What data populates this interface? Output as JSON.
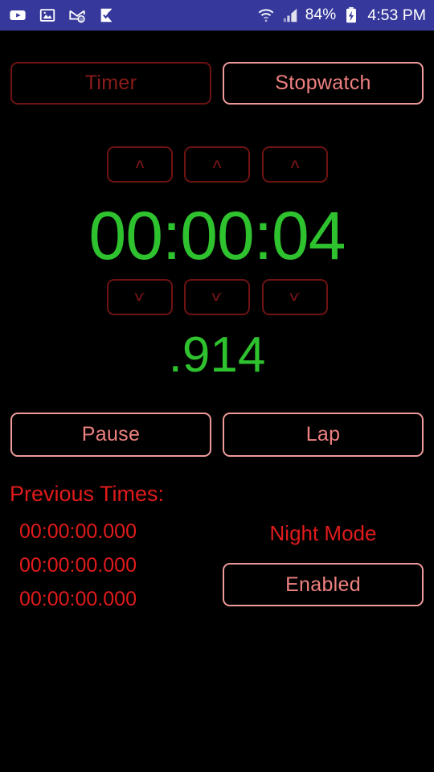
{
  "status_bar": {
    "background_color": "#36399b",
    "left_icons": [
      {
        "name": "youtube-icon",
        "glyph": "youtube"
      },
      {
        "name": "gallery-image-icon",
        "glyph": "image"
      },
      {
        "name": "email-at-icon",
        "glyph": "envelope-at"
      },
      {
        "name": "checkmark-flag-icon",
        "glyph": "flag-check"
      }
    ],
    "wifi_icon": "wifi-icon",
    "signal_icon": "cellular-signal-icon",
    "battery_percent": "84%",
    "battery_icon": "battery-charging-icon",
    "time": "4:53 PM"
  },
  "colors": {
    "background": "#000000",
    "accent_active": "#ef8080",
    "accent_inactive": "#8b1b1b",
    "border_active": "#ef9a9a",
    "border_inactive": "#6e1212",
    "clock_green": "#2fc22f",
    "label_red": "#e01b1b"
  },
  "modes": {
    "timer_label": "Timer",
    "stopwatch_label": "Stopwatch",
    "selected": "Stopwatch"
  },
  "steppers": {
    "up_glyph": "ʌ",
    "down_glyph": "ѵ",
    "up_buttons": [
      {
        "name": "hours-increment-button"
      },
      {
        "name": "minutes-increment-button"
      },
      {
        "name": "seconds-increment-button"
      }
    ],
    "down_buttons": [
      {
        "name": "hours-decrement-button"
      },
      {
        "name": "minutes-decrement-button"
      },
      {
        "name": "seconds-decrement-button"
      }
    ]
  },
  "clock": {
    "main": "00:00:04",
    "milliseconds": ".914"
  },
  "actions": {
    "pause_label": "Pause",
    "lap_label": "Lap"
  },
  "previous_times": {
    "title": "Previous Times:",
    "entries": [
      "00:00:00.000",
      "00:00:00.000",
      "00:00:00.000"
    ]
  },
  "night_mode": {
    "label": "Night Mode",
    "state_label": "Enabled"
  }
}
